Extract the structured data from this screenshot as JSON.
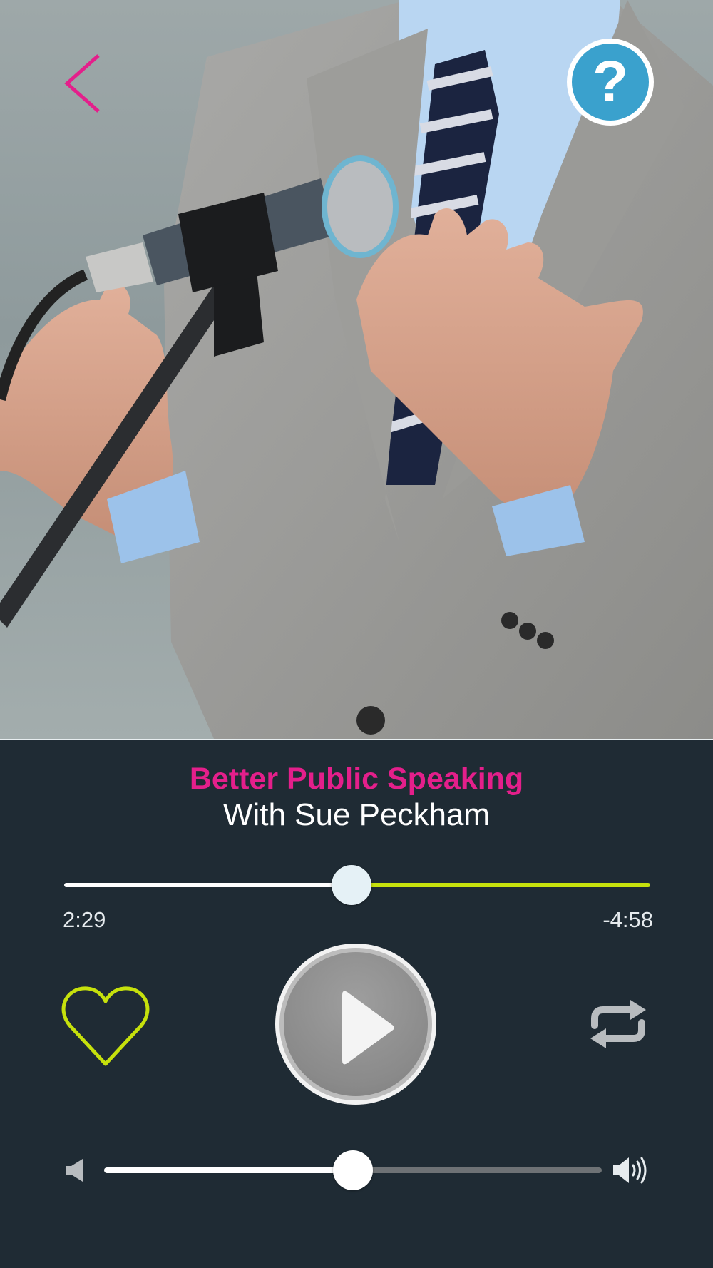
{
  "hero": {
    "image": "speaker-at-microphone-photo"
  },
  "header": {
    "back_icon": "chevron-left-icon",
    "help_label": "?",
    "help_icon": "help-icon"
  },
  "track": {
    "title": "Better Public Speaking",
    "subtitle": "With Sue Peckham"
  },
  "playback": {
    "progress_fraction": 0.49,
    "elapsed": "2:29",
    "remaining": "-4:58"
  },
  "controls": {
    "favorite_icon": "heart-outline-icon",
    "play_icon": "play-icon",
    "repeat_icon": "repeat-icon"
  },
  "volume": {
    "level_fraction": 0.5,
    "low_icon": "volume-low-icon",
    "high_icon": "volume-high-icon"
  },
  "colors": {
    "background": "#1f2b34",
    "title": "#e41f8b",
    "accent": "#c6e10c",
    "help": "#3aa1cd",
    "back": "#e41f8b"
  }
}
